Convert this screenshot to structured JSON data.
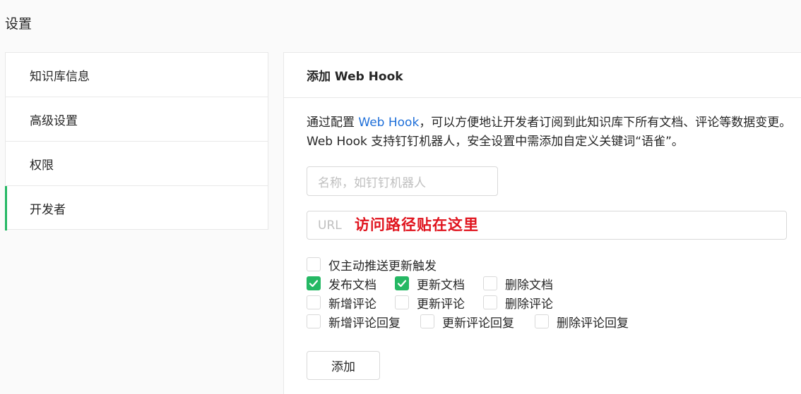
{
  "page": {
    "title": "设置"
  },
  "sidebar": {
    "items": [
      {
        "label": "知识库信息",
        "active": false
      },
      {
        "label": "高级设置",
        "active": false
      },
      {
        "label": "权限",
        "active": false
      },
      {
        "label": "开发者",
        "active": true
      }
    ]
  },
  "panel": {
    "title": "添加 Web Hook",
    "description": {
      "prefix": "通过配置 ",
      "link": "Web Hook",
      "suffix": "，可以方便地让开发者订阅到此知识库下所有文档、评论等数据变更。Web Hook 支持钉钉机器人，安全设置中需添加自定义关键词“语雀”。"
    },
    "name_input": {
      "placeholder": "名称，如钉钉机器人",
      "value": ""
    },
    "url_input": {
      "placeholder": "URL",
      "value": ""
    },
    "url_annotation": "访问路径贴在这里",
    "checkboxes": {
      "active_push_only": {
        "label": "仅主动推送更新触发",
        "checked": false
      },
      "publish_doc": {
        "label": "发布文档",
        "checked": true
      },
      "update_doc": {
        "label": "更新文档",
        "checked": true
      },
      "delete_doc": {
        "label": "删除文档",
        "checked": false
      },
      "new_comment": {
        "label": "新增评论",
        "checked": false
      },
      "update_comment": {
        "label": "更新评论",
        "checked": false
      },
      "delete_comment": {
        "label": "删除评论",
        "checked": false
      },
      "new_reply": {
        "label": "新增评论回复",
        "checked": false
      },
      "update_reply": {
        "label": "更新评论回复",
        "checked": false
      },
      "delete_reply": {
        "label": "删除评论回复",
        "checked": false
      }
    },
    "add_button": "添加"
  },
  "colors": {
    "accent": "#25b864",
    "link": "#1e6fd9",
    "annotation": "#e0141e"
  }
}
